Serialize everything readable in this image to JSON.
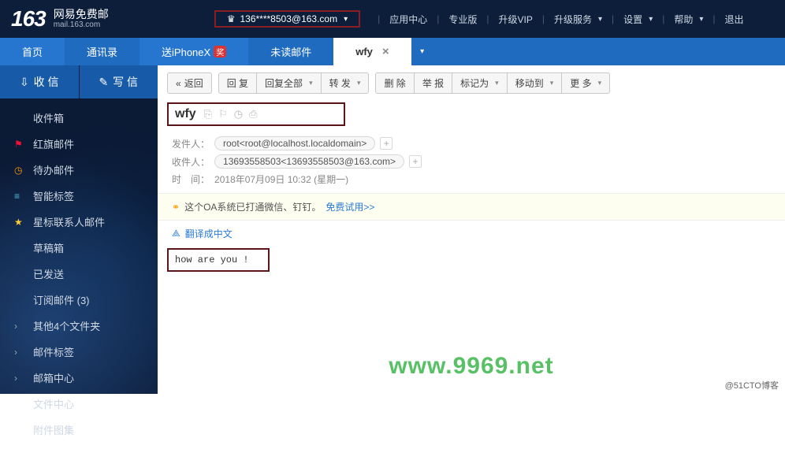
{
  "header": {
    "logo_num": "163",
    "logo_cn": "网易免费邮",
    "logo_en": "mail.163.com",
    "user_email": "136****8503@163.com",
    "links": {
      "app_center": "应用中心",
      "pro": "专业版",
      "vip": "升级VIP",
      "upgrade_service": "升级服务",
      "settings": "设置",
      "help": "帮助",
      "logout": "退出"
    }
  },
  "tabs": {
    "home": "首页",
    "contacts": "通讯录",
    "iphone": "送iPhoneX",
    "iphone_badge": "奖",
    "unread": "未读邮件",
    "current": "wfy"
  },
  "sidebar": {
    "receive": "收 信",
    "compose": "写 信",
    "items": {
      "inbox": "收件箱",
      "flag": "红旗邮件",
      "todo": "待办邮件",
      "smart": "智能标签",
      "starred": "星标联系人邮件",
      "draft": "草稿箱",
      "sent": "已发送",
      "subscribe": "订阅邮件 (3)",
      "other": "其他4个文件夹",
      "tags": "邮件标签",
      "center": "邮箱中心",
      "files": "文件中心",
      "photos": "附件图集"
    }
  },
  "toolbar": {
    "back": "返回",
    "reply": "回 复",
    "reply_all": "回复全部",
    "forward": "转 发",
    "delete": "删 除",
    "report": "举 报",
    "mark": "标记为",
    "move": "移动到",
    "more": "更 多"
  },
  "mail": {
    "subject": "wfy",
    "sender_label": "发件人：",
    "sender": "root<root@localhost.localdomain>",
    "recipient_label": "收件人：",
    "recipient": "13693558503<13693558503@163.com>",
    "time_label": "时　间：",
    "time": "2018年07月09日 10:32 (星期一)",
    "promo_text": "这个OA系统已打通微信、钉钉。",
    "promo_link": "免费试用>>",
    "translate": "翻译成中文",
    "body": "how  are  you !"
  },
  "watermark": "www.9969.net",
  "footer": "@51CTO博客"
}
